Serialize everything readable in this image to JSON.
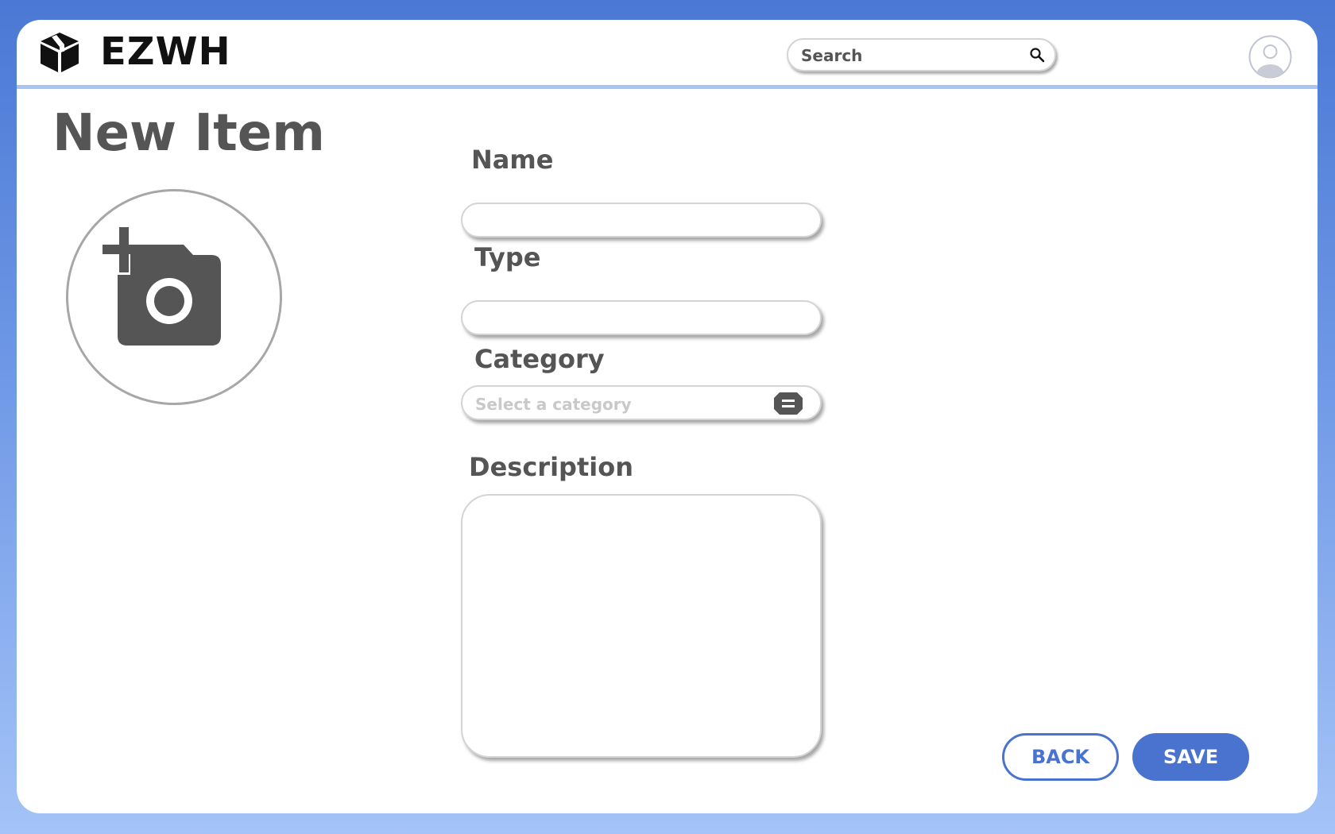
{
  "header": {
    "brand": "EZWH",
    "logo_icon": "box-icon",
    "search": {
      "placeholder": "Search",
      "value": "",
      "icon": "search-icon"
    },
    "avatar_icon": "user-avatar-icon"
  },
  "page": {
    "title": "New Item",
    "photo_upload_icon": "add-photo-icon"
  },
  "form": {
    "name": {
      "label": "Name",
      "value": ""
    },
    "type": {
      "label": "Type",
      "value": ""
    },
    "category": {
      "label": "Category",
      "placeholder": "Select a category",
      "icon": "list-icon"
    },
    "description": {
      "label": "Description",
      "value": ""
    }
  },
  "actions": {
    "back_label": "BACK",
    "save_label": "SAVE"
  },
  "colors": {
    "accent": "#4a72cf",
    "header_divider": "#a8c4f3",
    "text_dark": "#555555",
    "placeholder": "#c9c9c9"
  }
}
